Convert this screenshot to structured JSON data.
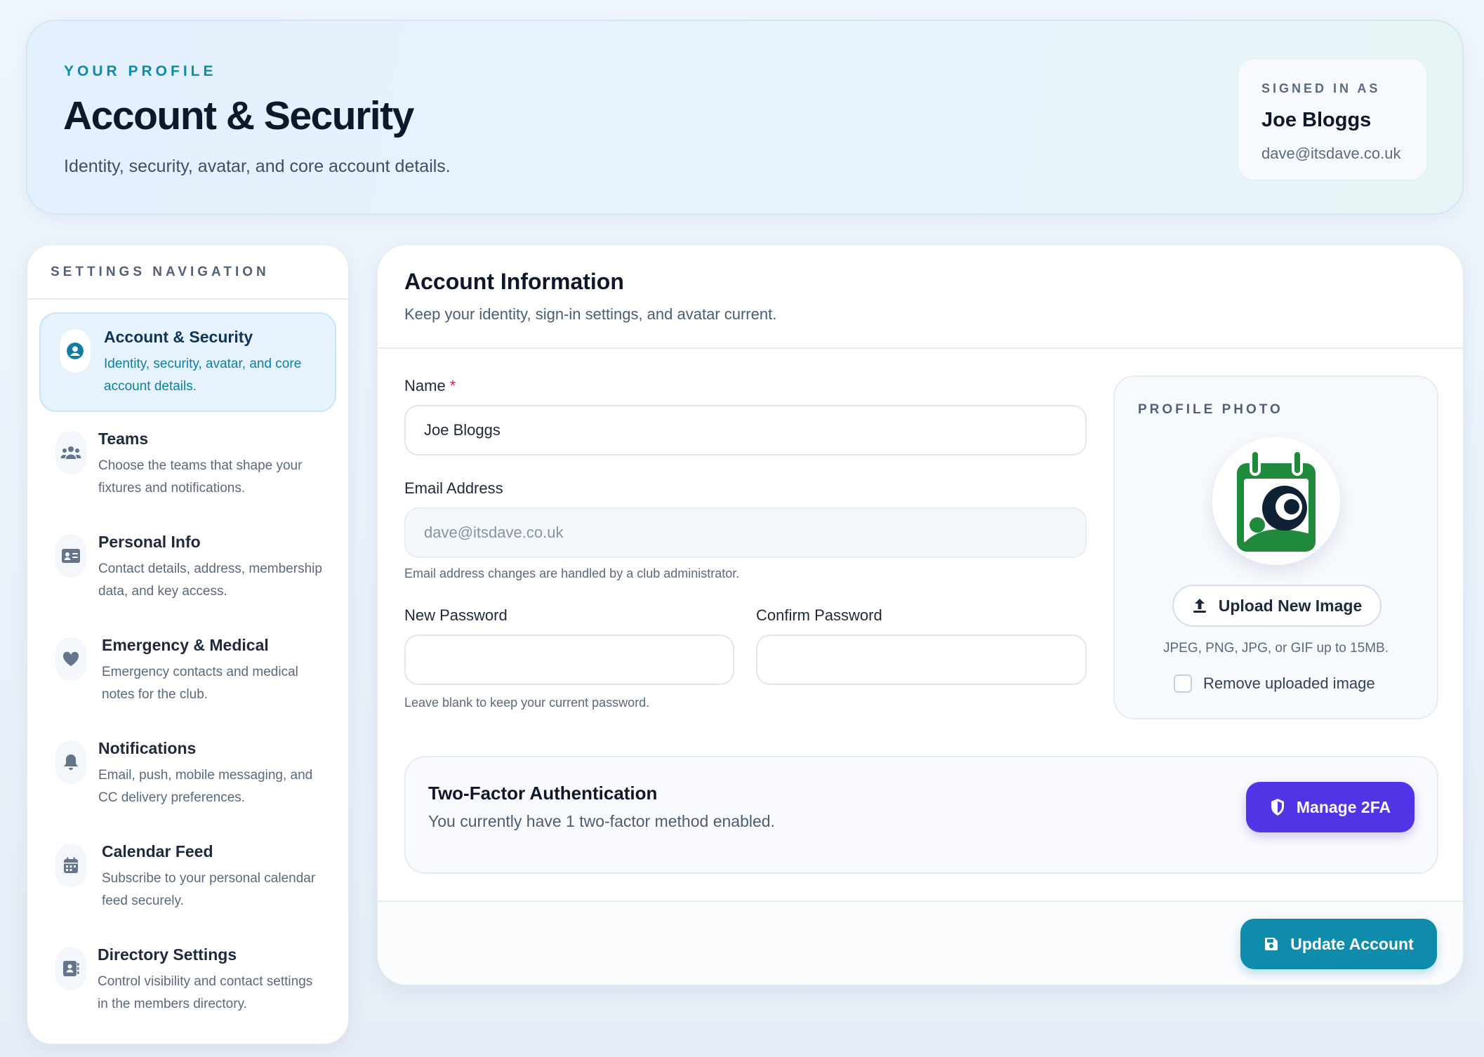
{
  "hero": {
    "eyebrow": "YOUR PROFILE",
    "title": "Account & Security",
    "subtitle": "Identity, security, avatar, and core account details.",
    "signed_in": {
      "eyebrow": "SIGNED IN AS",
      "name": "Joe Bloggs",
      "email": "dave@itsdave.co.uk"
    }
  },
  "sidebar": {
    "heading": "SETTINGS NAVIGATION",
    "items": [
      {
        "title": "Account & Security",
        "desc": "Identity, security, avatar, and core account details.",
        "icon": "user-circle-icon",
        "active": true
      },
      {
        "title": "Teams",
        "desc": "Choose the teams that shape your fixtures and notifications.",
        "icon": "users-icon",
        "active": false
      },
      {
        "title": "Personal Info",
        "desc": "Contact details, address, membership data, and key access.",
        "icon": "id-card-icon",
        "active": false
      },
      {
        "title": "Emergency & Medical",
        "desc": "Emergency contacts and medical notes for the club.",
        "icon": "heart-icon",
        "active": false
      },
      {
        "title": "Notifications",
        "desc": "Email, push, mobile messaging, and CC delivery preferences.",
        "icon": "bell-icon",
        "active": false
      },
      {
        "title": "Calendar Feed",
        "desc": "Subscribe to your personal calendar feed securely.",
        "icon": "calendar-icon",
        "active": false
      },
      {
        "title": "Directory Settings",
        "desc": "Control visibility and contact settings in the members directory.",
        "icon": "address-book-icon",
        "active": false
      }
    ]
  },
  "main": {
    "title": "Account Information",
    "subtitle": "Keep your identity, sign-in settings, and avatar current.",
    "name_label": "Name",
    "name_required": "*",
    "name_value": "Joe Bloggs",
    "email_label": "Email Address",
    "email_value": "dave@itsdave.co.uk",
    "email_help": "Email address changes are handled by a club administrator.",
    "new_password_label": "New Password",
    "new_password_value": "",
    "confirm_password_label": "Confirm Password",
    "confirm_password_value": "",
    "password_help": "Leave blank to keep your current password.",
    "photo": {
      "heading": "PROFILE PHOTO",
      "upload_label": "Upload New Image",
      "help": "JPEG, PNG, JPG, or GIF up to 15MB.",
      "remove_label": "Remove uploaded image",
      "remove_checked": false
    },
    "tfa": {
      "title": "Two-Factor Authentication",
      "subtitle": "You currently have 1 two-factor method enabled.",
      "button": "Manage 2FA"
    },
    "update_button": "Update Account"
  },
  "colors": {
    "accent_teal": "#0f8bab",
    "accent_purple": "#4f35e6",
    "logo_green": "#1f8a3b"
  }
}
